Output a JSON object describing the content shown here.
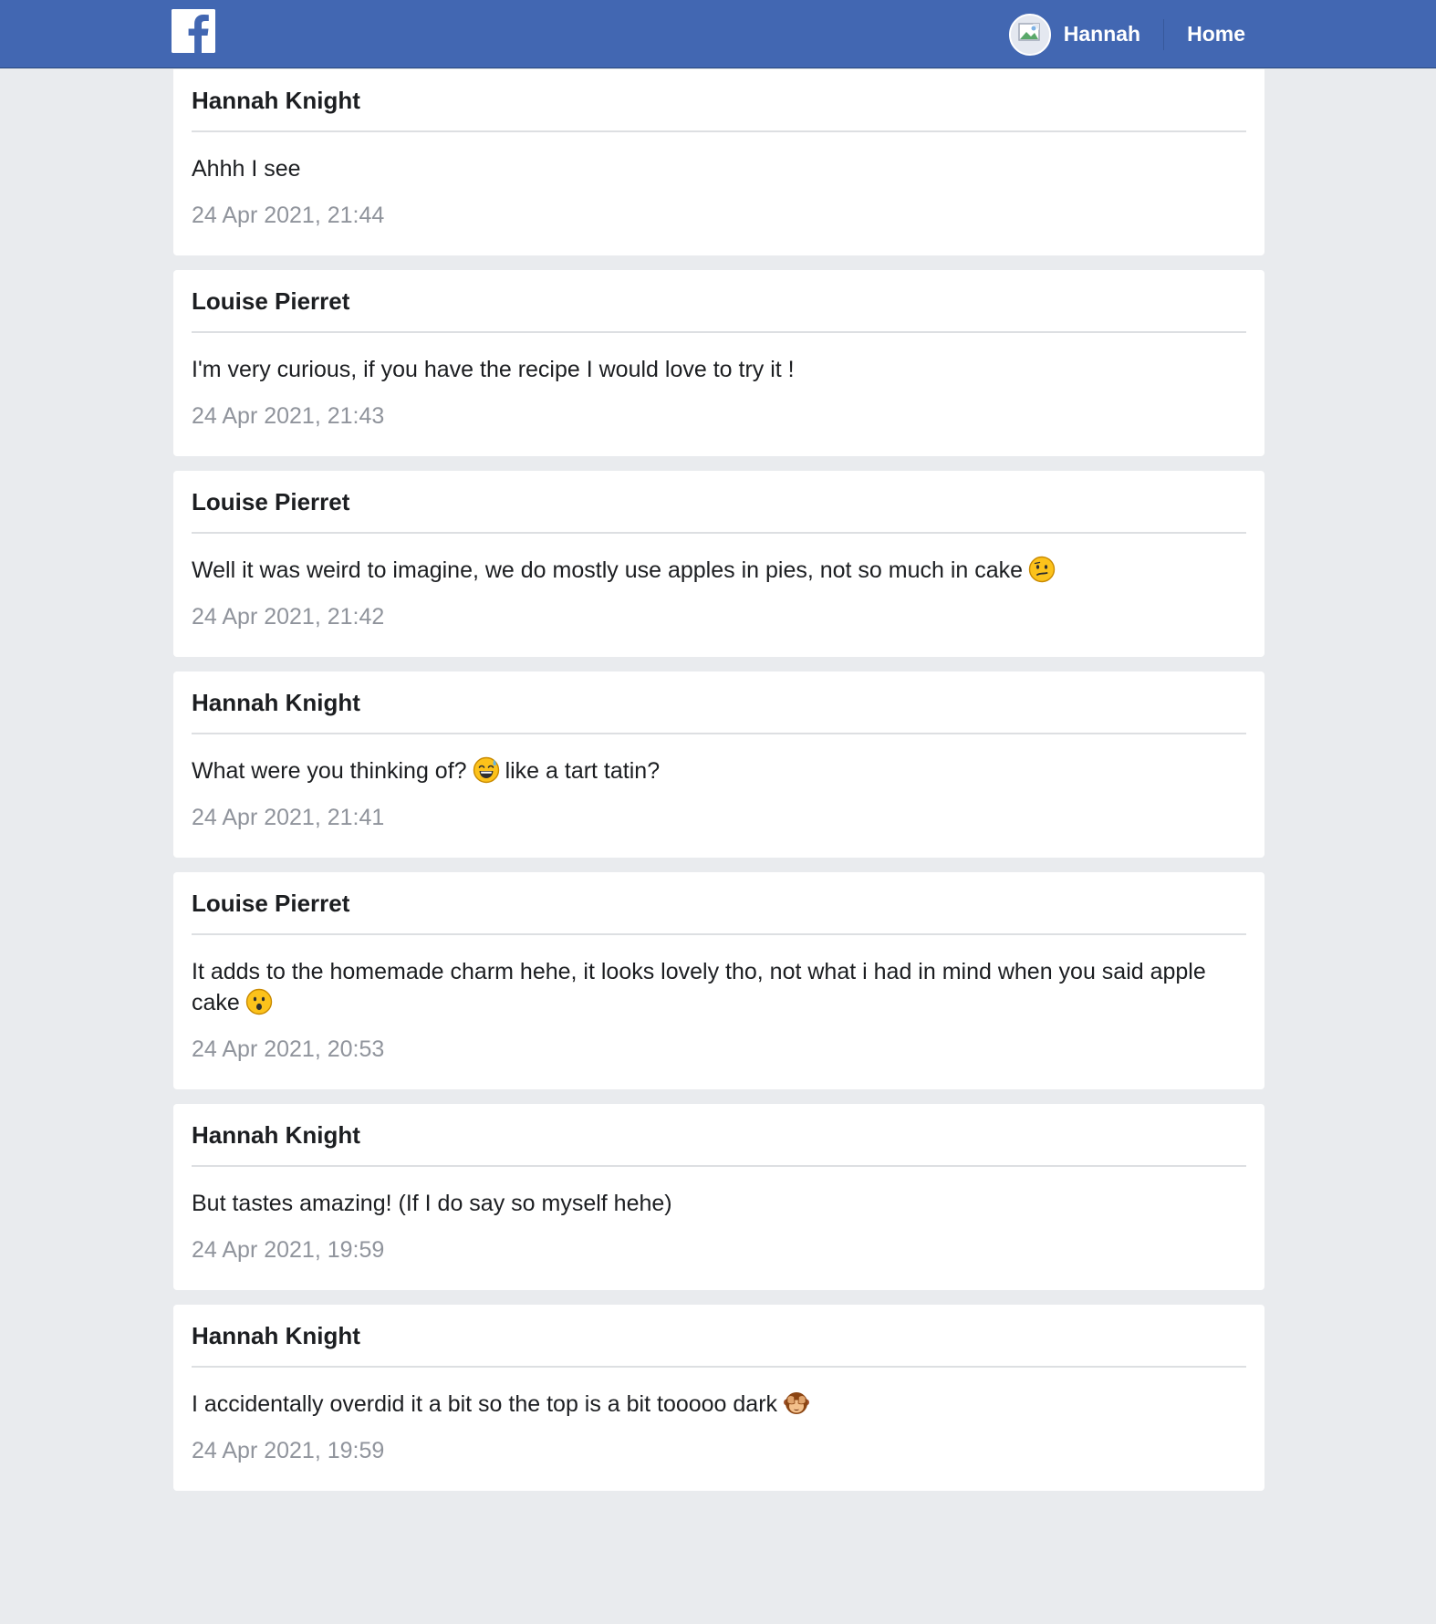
{
  "header": {
    "logo_icon": "facebook-logo-icon",
    "avatar_icon": "broken-image-avatar-icon",
    "user_link": "Hannah",
    "home_link": "Home",
    "bar_color": "#4267b2"
  },
  "messages": [
    {
      "author": "Hannah Knight",
      "text": "Ahhh I see",
      "time": "24 Apr 2021, 21:44"
    },
    {
      "author": "Louise Pierret",
      "text": "I'm very curious, if you have the recipe I would love to try it !",
      "time": "24 Apr 2021, 21:43"
    },
    {
      "author": "Louise Pierret",
      "text": "Well it was weird to imagine, we do mostly use apples in pies, not so much in cake",
      "emoji": "confused-face-emoji-icon",
      "time": "24 Apr 2021, 21:42"
    },
    {
      "author": "Hannah Knight",
      "text_before": "What were you thinking of?",
      "emoji": "grinning-sweat-emoji-icon",
      "text_after": "like a tart tatin?",
      "time": "24 Apr 2021, 21:41"
    },
    {
      "author": "Louise Pierret",
      "text": "It adds to the homemade charm hehe, it looks lovely tho, not what i had in mind when you said apple cake",
      "emoji": "hushed-face-emoji-icon",
      "time": "24 Apr 2021, 20:53"
    },
    {
      "author": "Hannah Knight",
      "text": "But tastes amazing! (If I do say so myself hehe)",
      "time": "24 Apr 2021, 19:59"
    },
    {
      "author": "Hannah Knight",
      "text": "I accidentally overdid it a bit so the top is a bit tooooo dark",
      "emoji": "see-no-evil-monkey-emoji-icon",
      "time": "24 Apr 2021, 19:59"
    }
  ]
}
